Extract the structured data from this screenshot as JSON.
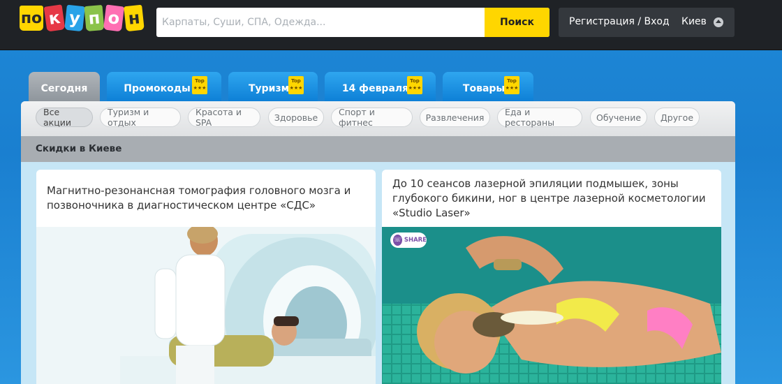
{
  "brand": {
    "letters": [
      "по",
      "к",
      "у",
      "п",
      "о",
      "н"
    ],
    "colors": [
      "#ffd600",
      "#e63946",
      "#29a3e8",
      "#8bc34a",
      "#ff6fb3",
      "#ffd600"
    ]
  },
  "search": {
    "placeholder": "Карпаты, Суши, СПА, Одежда...",
    "button_label": "Поиск"
  },
  "account": {
    "register_login": "Регистрация / Вход",
    "city": "Киев"
  },
  "tabs": [
    {
      "label": "Сегодня",
      "active": true,
      "top": false
    },
    {
      "label": "Промокоды",
      "active": false,
      "top": true
    },
    {
      "label": "Туризм",
      "active": false,
      "top": true
    },
    {
      "label": "14 февраля",
      "active": false,
      "top": true
    },
    {
      "label": "Товары",
      "active": false,
      "top": true
    }
  ],
  "top_badge": "Top ★★★",
  "filters": [
    {
      "label": "Все акции",
      "active": true
    },
    {
      "label": "Туризм и отдых",
      "active": false
    },
    {
      "label": "Красота и SPA",
      "active": false
    },
    {
      "label": "Здоровье",
      "active": false
    },
    {
      "label": "Спорт и фитнес",
      "active": false
    },
    {
      "label": "Развлечения",
      "active": false
    },
    {
      "label": "Еда и рестораны",
      "active": false
    },
    {
      "label": "Обучение",
      "active": false
    },
    {
      "label": "Другое",
      "active": false
    }
  ],
  "section_title": "Скидки в Киеве",
  "deals": [
    {
      "title": "Магнитно-резонансная томография головного мозга и позвоночника в диагностическом центре «СДС»"
    },
    {
      "title": "До 10 сеансов лазерной эпиляции подмышек, зоны глубокого бикини, ног в центре лазерной косметологии «Studio Laser»",
      "share_label": "SHARE"
    }
  ],
  "colors": {
    "accent_yellow": "#ffd600",
    "tab_blue": "#1a8ae0",
    "header_dark": "#1f2226"
  }
}
